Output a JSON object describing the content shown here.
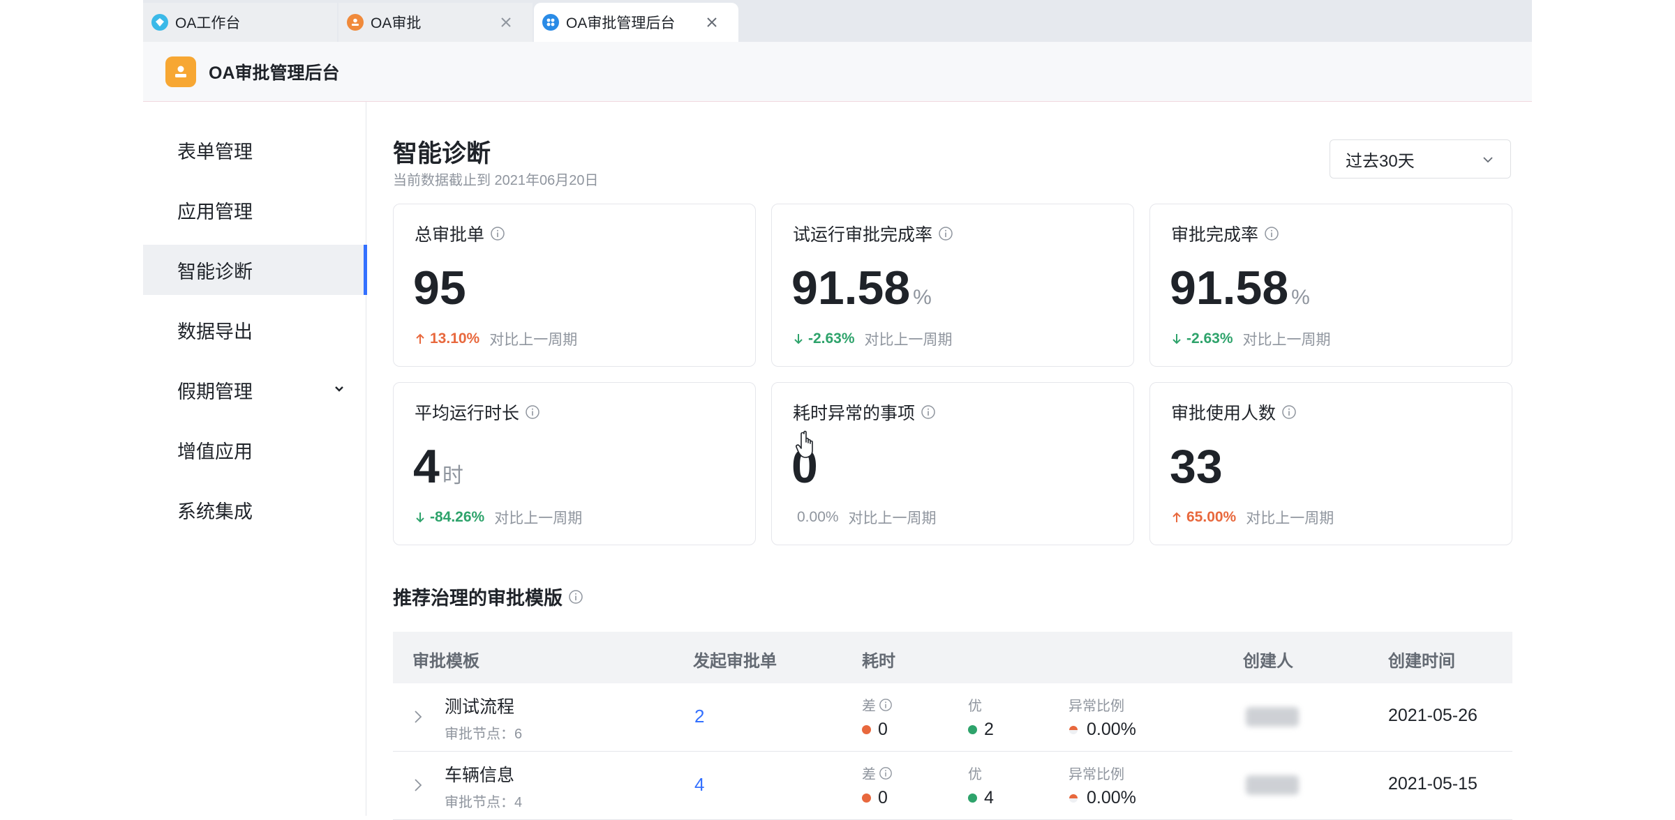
{
  "tabs": [
    {
      "label": "OA工作台",
      "icon": "diamond-icon",
      "color": "#3bb9e8"
    },
    {
      "label": "OA审批",
      "icon": "stamp-icon",
      "color": "#f08a3b"
    },
    {
      "label": "OA审批管理后台",
      "icon": "grid-icon",
      "color": "#2a8be6"
    }
  ],
  "app": {
    "title": "OA审批管理后台",
    "logo_icon": "stamp-icon",
    "accent": "#f7a733"
  },
  "sidebar": {
    "items": [
      {
        "label": "表单管理"
      },
      {
        "label": "应用管理"
      },
      {
        "label": "智能诊断",
        "active": true
      },
      {
        "label": "数据导出"
      },
      {
        "label": "假期管理",
        "expandable": true
      },
      {
        "label": "增值应用"
      },
      {
        "label": "系统集成"
      }
    ]
  },
  "page": {
    "title": "智能诊断",
    "subtitle": "当前数据截止到 2021年06月20日",
    "range": "过去30天"
  },
  "cards": [
    {
      "label": "总审批单",
      "value": "95",
      "unit": "",
      "trend": "13.10%",
      "direction": "up",
      "compare": "对比上一周期"
    },
    {
      "label": "试运行审批完成率",
      "value": "91.58",
      "unit": "%",
      "trend": "-2.63%",
      "direction": "down",
      "compare": "对比上一周期"
    },
    {
      "label": "审批完成率",
      "value": "91.58",
      "unit": "%",
      "trend": "-2.63%",
      "direction": "down",
      "compare": "对比上一周期"
    },
    {
      "label": "平均运行时长",
      "value": "4",
      "unit": "时",
      "trend": "-84.26%",
      "direction": "down",
      "compare": "对比上一周期"
    },
    {
      "label": "耗时异常的事项",
      "value": "0",
      "unit": "",
      "trend": "0.00%",
      "direction": "flat",
      "compare": "对比上一周期"
    },
    {
      "label": "审批使用人数",
      "value": "33",
      "unit": "",
      "trend": "65.00%",
      "direction": "up",
      "compare": "对比上一周期"
    }
  ],
  "recommend": {
    "title": "推荐治理的审批模版",
    "columns": [
      "审批模板",
      "发起审批单",
      "耗时",
      "创建人",
      "创建时间"
    ],
    "rows": [
      {
        "name": "测试流程",
        "nodes": "审批节点：6",
        "count": "2",
        "bad_label": "差",
        "bad": "0",
        "good_label": "优",
        "good": "2",
        "ratio_label": "异常比例",
        "ratio": "0.00%",
        "created": "2021-05-26"
      },
      {
        "name": "车辆信息",
        "nodes": "审批节点：4",
        "count": "4",
        "bad_label": "差",
        "bad": "0",
        "good_label": "优",
        "good": "4",
        "ratio_label": "异常比例",
        "ratio": "0.00%",
        "created": "2021-05-15"
      }
    ]
  },
  "colors": {
    "up": "#e8683d",
    "down": "#2ea36b",
    "link": "#3370ff",
    "bad_dot": "#e8683d",
    "good_dot": "#2ea36b"
  }
}
